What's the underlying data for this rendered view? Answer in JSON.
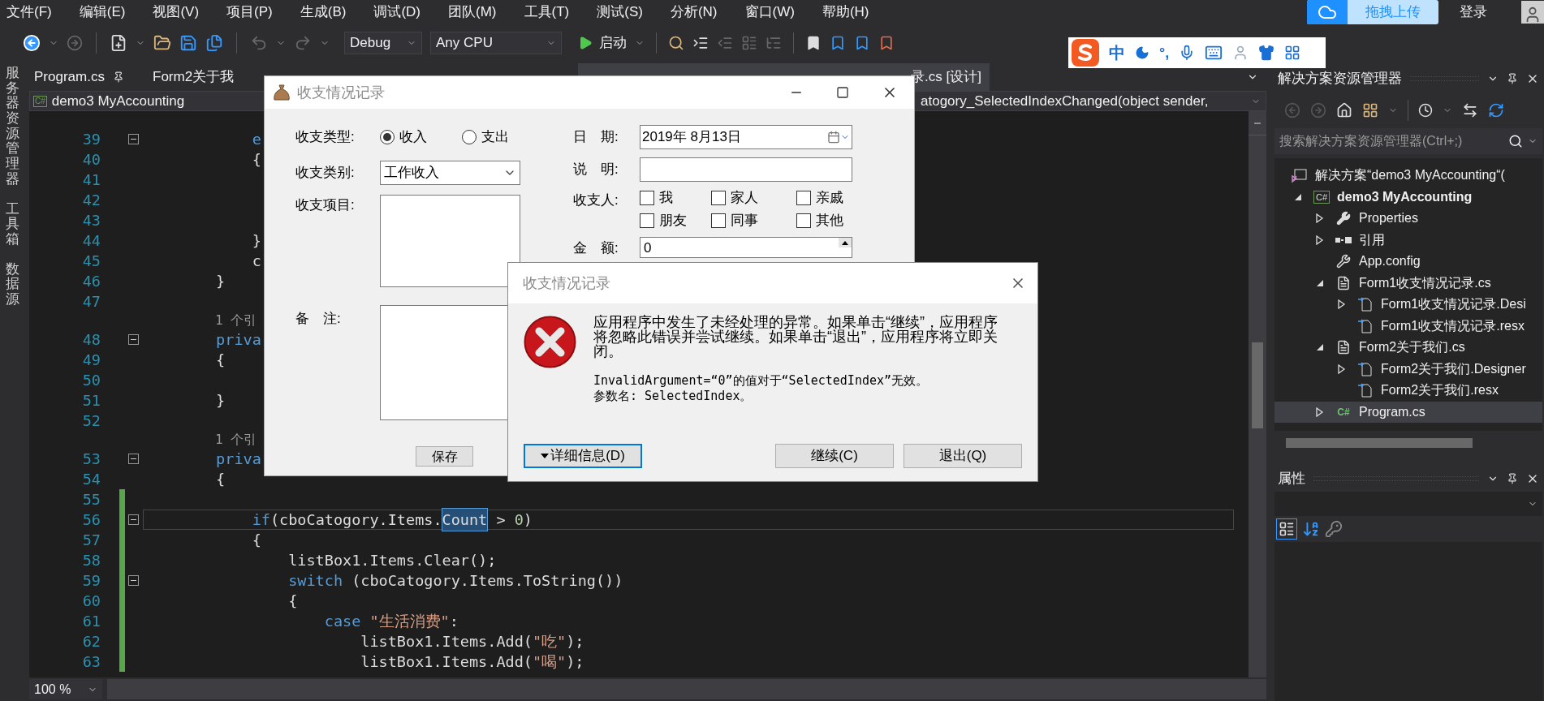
{
  "menu": [
    "文件(F)",
    "编辑(E)",
    "视图(V)",
    "项目(P)",
    "生成(B)",
    "调试(D)",
    "团队(M)",
    "工具(T)",
    "测试(S)",
    "分析(N)",
    "窗口(W)",
    "帮助(H)"
  ],
  "toolbar": {
    "configuration": "Debug",
    "platform": "Any CPU",
    "start": "启动"
  },
  "account": {
    "upload": "拖拽上传",
    "login": "登录"
  },
  "ime_bar": {
    "mode": "中",
    "punctuation": "°,"
  },
  "side_tabs": [
    "服务器资源管理器",
    "工具箱",
    "数据源"
  ],
  "editor": {
    "tabs": [
      {
        "label": "Program.cs",
        "pinned": true,
        "selected": false
      },
      {
        "label": "Form2关于我",
        "pinned": false,
        "selected": false
      },
      {
        "label": "录.cs [设计]",
        "pinned": false,
        "selected": true
      }
    ],
    "project_icon": "C#",
    "project": "demo3 MyAccounting",
    "member": "atogory_SelectedIndexChanged(object sender,",
    "lines": [
      {
        "kind": "code",
        "number": "39",
        "fold": true,
        "changed": false,
        "current": false,
        "tokens": [
          {
            "text": "            e",
            "kind": "keyword"
          }
        ]
      },
      {
        "kind": "code",
        "number": "40",
        "fold": false,
        "changed": false,
        "current": false,
        "tokens": [
          {
            "text": "            {",
            "kind": "plain"
          }
        ]
      },
      {
        "kind": "code",
        "number": "41",
        "fold": false,
        "changed": false,
        "current": false
      },
      {
        "kind": "code",
        "number": "42",
        "fold": false,
        "changed": false,
        "current": false
      },
      {
        "kind": "code",
        "number": "43",
        "fold": false,
        "changed": false,
        "current": false
      },
      {
        "kind": "code",
        "number": "44",
        "fold": false,
        "changed": false,
        "current": false,
        "tokens": [
          {
            "text": "            }",
            "kind": "plain"
          }
        ]
      },
      {
        "kind": "code",
        "number": "45",
        "fold": false,
        "changed": false,
        "current": false,
        "tokens": [
          {
            "text": "            c",
            "kind": "plain"
          }
        ]
      },
      {
        "kind": "code",
        "number": "46",
        "fold": false,
        "changed": false,
        "current": false,
        "tokens": [
          {
            "text": "        }",
            "kind": "plain"
          }
        ]
      },
      {
        "kind": "code",
        "number": "47",
        "fold": false,
        "changed": false,
        "current": false
      },
      {
        "kind": "codelens",
        "text": "1 个引"
      },
      {
        "kind": "code",
        "number": "48",
        "fold": true,
        "changed": false,
        "current": false,
        "tokens": [
          {
            "text": "        priva",
            "kind": "keyword"
          }
        ]
      },
      {
        "kind": "code",
        "number": "49",
        "fold": false,
        "changed": false,
        "current": false,
        "tokens": [
          {
            "text": "        {",
            "kind": "plain"
          }
        ]
      },
      {
        "kind": "code",
        "number": "50",
        "fold": false,
        "changed": false,
        "current": false
      },
      {
        "kind": "code",
        "number": "51",
        "fold": false,
        "changed": false,
        "current": false,
        "tokens": [
          {
            "text": "        }",
            "kind": "plain"
          }
        ]
      },
      {
        "kind": "code",
        "number": "52",
        "fold": false,
        "changed": false,
        "current": false
      },
      {
        "kind": "codelens",
        "text": "1 个引"
      },
      {
        "kind": "code",
        "number": "53",
        "fold": true,
        "changed": false,
        "current": false,
        "tokens": [
          {
            "text": "        priva",
            "kind": "keyword"
          }
        ]
      },
      {
        "kind": "code",
        "number": "54",
        "fold": false,
        "changed": false,
        "current": false,
        "tokens": [
          {
            "text": "        {",
            "kind": "plain"
          }
        ]
      },
      {
        "kind": "code",
        "number": "55",
        "fold": false,
        "changed": true,
        "current": false
      },
      {
        "kind": "code",
        "number": "56",
        "fold": true,
        "changed": true,
        "current": true,
        "tokens": [
          {
            "text": "            if",
            "kind": "keyword"
          },
          {
            "text": "(cboCatogory.Items.",
            "kind": "plain"
          },
          {
            "text": "Count",
            "kind": "match"
          },
          {
            "text": " > ",
            "kind": "plain"
          },
          {
            "text": "0",
            "kind": "number"
          },
          {
            "text": ")",
            "kind": "plain"
          }
        ]
      },
      {
        "kind": "code",
        "number": "57",
        "fold": false,
        "changed": true,
        "current": false,
        "tokens": [
          {
            "text": "            {",
            "kind": "plain"
          }
        ]
      },
      {
        "kind": "code",
        "number": "58",
        "fold": false,
        "changed": true,
        "current": false,
        "tokens": [
          {
            "text": "                listBox1.Items.Clear();",
            "kind": "plain"
          }
        ]
      },
      {
        "kind": "code",
        "number": "59",
        "fold": true,
        "changed": true,
        "current": false,
        "tokens": [
          {
            "text": "                switch",
            "kind": "keyword"
          },
          {
            "text": " (cboCatogory.Items.ToString())",
            "kind": "plain"
          }
        ]
      },
      {
        "kind": "code",
        "number": "60",
        "fold": false,
        "changed": true,
        "current": false,
        "tokens": [
          {
            "text": "                {",
            "kind": "plain"
          }
        ]
      },
      {
        "kind": "code",
        "number": "61",
        "fold": false,
        "changed": true,
        "current": false,
        "tokens": [
          {
            "text": "                    case",
            "kind": "keyword"
          },
          {
            "text": " \"生活消费\"",
            "kind": "string"
          },
          {
            "text": ":",
            "kind": "plain"
          }
        ]
      },
      {
        "kind": "code",
        "number": "62",
        "fold": false,
        "changed": true,
        "current": false,
        "tokens": [
          {
            "text": "                        listBox1.Items.Add(",
            "kind": "plain"
          },
          {
            "text": "\"吃\"",
            "kind": "string"
          },
          {
            "text": ");",
            "kind": "plain"
          }
        ]
      },
      {
        "kind": "code",
        "number": "63",
        "fold": false,
        "changed": true,
        "current": false,
        "tokens": [
          {
            "text": "                        listBox1.Items.Add(",
            "kind": "plain"
          },
          {
            "text": "\"喝\"",
            "kind": "string"
          },
          {
            "text": ");",
            "kind": "plain"
          }
        ]
      }
    ],
    "zoom": "100 %"
  },
  "form_window": {
    "title": "收支情况记录",
    "type_label": "收支类型:",
    "type_options": [
      {
        "label": "收入",
        "selected": true
      },
      {
        "label": "支出",
        "selected": false
      }
    ],
    "category_label": "收支类别:",
    "category_value": "工作收入",
    "items_label": "收支项目:",
    "note_label": "备　注:",
    "save_button": "保存",
    "date_label": "日　期:",
    "date_value": "2019年  8月13日",
    "desc_label": "说　明:",
    "people_label": "收支人:",
    "people": [
      {
        "label": "我",
        "checked": false
      },
      {
        "label": "家人",
        "checked": false
      },
      {
        "label": "亲戚",
        "checked": false
      },
      {
        "label": "朋友",
        "checked": false
      },
      {
        "label": "同事",
        "checked": false
      },
      {
        "label": "其他",
        "checked": false
      }
    ],
    "amount_label": "金　额:",
    "amount_value": "0"
  },
  "error_dialog": {
    "title": "收支情况记录",
    "message": "应用程序中发生了未经处理的异常。如果单击“继续”，应用程序将忽略此错误并尝试继续。如果单击“退出”，应用程序将立即关闭。",
    "detail_lines": [
      "InvalidArgument=“0”的值对于“SelectedIndex”无效。",
      "参数名: SelectedIndex。"
    ],
    "buttons": [
      {
        "label": "详细信息(D)",
        "kind": "details",
        "focused": true
      },
      {
        "label": "继续(C)",
        "kind": "action",
        "focused": false
      },
      {
        "label": "退出(Q)",
        "kind": "action",
        "focused": false
      }
    ]
  },
  "solution_explorer": {
    "title": "解决方案资源管理器",
    "search_placeholder": "搜索解决方案资源管理器(Ctrl+;)",
    "tree": [
      {
        "label": "解决方案“demo3 MyAccounting“(",
        "kind": "solution",
        "selected": false,
        "children": [
          {
            "label": "demo3 MyAccounting",
            "kind": "project",
            "icon_text": "C#",
            "expanded": true,
            "selected": false,
            "children": [
              {
                "label": "Properties",
                "kind": "properties",
                "expanded": false,
                "selected": false
              },
              {
                "label": "引用",
                "kind": "references",
                "expanded": false,
                "selected": false
              },
              {
                "label": "App.config",
                "kind": "config",
                "selected": false
              },
              {
                "label": "Form1收支情况记录.cs",
                "kind": "form",
                "expanded": true,
                "selected": false,
                "children": [
                  {
                    "label": "Form1收支情况记录.Desi",
                    "kind": "file",
                    "expanded": false,
                    "selected": false
                  },
                  {
                    "label": "Form1收支情况记录.resx",
                    "kind": "file",
                    "selected": false
                  }
                ]
              },
              {
                "label": "Form2关于我们.cs",
                "kind": "form",
                "expanded": true,
                "selected": false,
                "children": [
                  {
                    "label": "Form2关于我们.Designer",
                    "kind": "file",
                    "expanded": false,
                    "selected": false
                  },
                  {
                    "label": "Form2关于我们.resx",
                    "kind": "file",
                    "selected": false
                  }
                ]
              },
              {
                "label": "Program.cs",
                "kind": "csharp",
                "icon_text": "C#",
                "expanded": false,
                "selected": true
              }
            ]
          }
        ]
      }
    ]
  },
  "properties": {
    "title": "属性"
  }
}
